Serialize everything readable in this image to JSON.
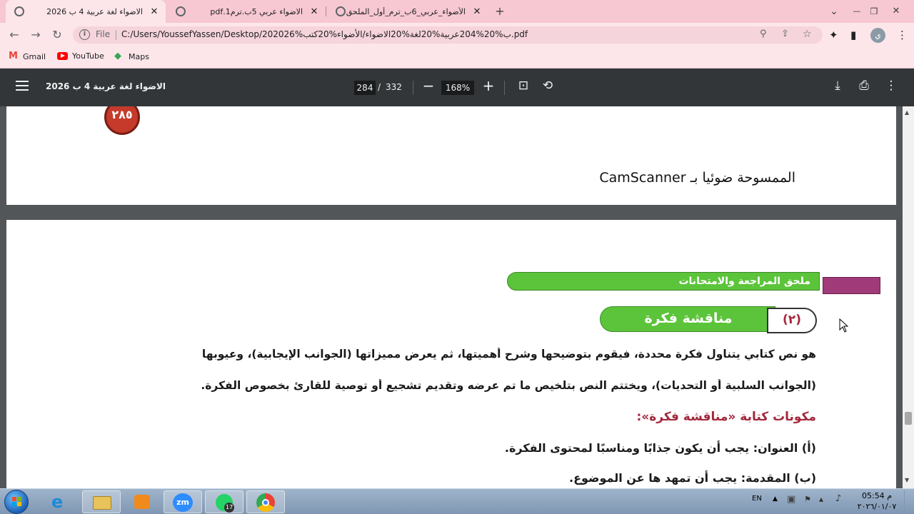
{
  "browser": {
    "tabs": [
      {
        "title": "الاضواء لغة عربية 4 ب 2026",
        "active": true
      },
      {
        "title": "الاضواء عربي 5ب.ترم1.pdf",
        "active": false
      },
      {
        "title": "الأضواء_عربي_6ب_ترم_أول_الملحق بداخ",
        "active": false
      }
    ],
    "new_tab": "+",
    "chevron": "⌄",
    "window_controls": {
      "minimize": "—",
      "restore": "❐",
      "close": "✕"
    },
    "address": {
      "scheme": "File",
      "url": "C:/Users/YoussefYassen/Desktop/202026%ب%20%204عربية%20لغة%20الاضواء/الأضواء%20كتب.pdf"
    },
    "profile_initial": "ي",
    "bookmarks": [
      {
        "label": "Gmail",
        "color": "#ea4335"
      },
      {
        "label": "YouTube",
        "color": "#ff0000"
      },
      {
        "label": "Maps",
        "color": "#34a853"
      }
    ]
  },
  "pdf_viewer": {
    "title": "الاضواء لغة عربية 4 ب 2026",
    "current_page": "284",
    "page_separator": "/",
    "total_pages": "332",
    "zoom": "168%"
  },
  "page_top": {
    "page_number_badge": "٢٨٥",
    "scanner_caption": "الممسوحة ضوئيا بـ CamScanner"
  },
  "page_main": {
    "header_banner": "ملحق المراجعة والامتحانات",
    "section_number": "(٢)",
    "section_title": "مناقشة فكرة",
    "paragraph_line1": "هو نص كتابي يتناول فكرة محددة، فيقوم بتوضيحها وشرح أهميتها، ثم يعرض مميزاتها (الجوانب الإيجابية)، وعيوبها",
    "paragraph_line2": "(الجوانب السلبية أو التحديات)، ويختتم النص بتلخيص ما تم عرضه وتقديم تشجيع أو توصية للقارئ بخصوص الفكرة.",
    "components_heading": "مكونات كتابة «مناقشة فكرة»:",
    "item_a": "(أ) العنوان: يجب أن يكون جذابًا ومناسبًا لمحتوى الفكرة.",
    "item_b_partial": "(ب) المقدمة: يجب أن تمهد ها عن الموضوع."
  },
  "taskbar": {
    "zoom_label": "zm",
    "whatsapp_badge": "17",
    "language": "EN",
    "time": "05:54 م",
    "date": "٢٠٢٦/٠١/٠٧"
  },
  "colors": {
    "tab_strip": "#f7c8d2",
    "toolbar": "#fde6ea",
    "pdf_toolbar": "#323639",
    "banner_green": "#5cc43a",
    "banner_purple": "#a13a78",
    "heading_maroon": "#a3273c",
    "badge_red": "#c53a2a"
  }
}
